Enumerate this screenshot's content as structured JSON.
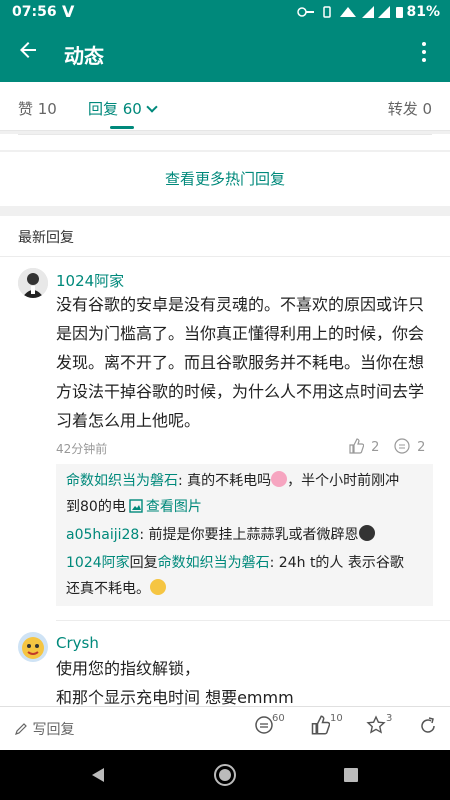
{
  "status_bar": {
    "time": "07:56",
    "battery": "81%"
  },
  "header": {
    "title": "动态"
  },
  "tabs": {
    "like": "赞 10",
    "reply": "回复 60",
    "forward": "转发 0"
  },
  "more_hot": "查看更多热门回复",
  "latest_label": "最新回复",
  "comments": [
    {
      "user": "1024阿家",
      "text_lines": [
        "没有谷歌的安卓是没有灵魂的。不喜欢的原因或许只",
        "是因为门槛高了。当你真正懂得利用上的时候，你会",
        "发现。离不开了。而且谷歌服务并不耗电。当你在想",
        "方设法干掉谷歌的时候，为什么人不用这点时间去学",
        "习着怎么用上他呢。"
      ],
      "time": "42分钟前",
      "likes": "2",
      "replies": "2",
      "subreplies": [
        {
          "user": "命数如织当为磐石",
          "text": ": 真的不耗电吗",
          "text2": "，半个小时前刚冲",
          "line2": "到80的电",
          "image_link": "查看图片"
        },
        {
          "user": "a05haiji28",
          "text": ": 前提是你要挂上蒜蒜乳或者微辟恩"
        },
        {
          "user": "1024阿家",
          "reply_word": "回复",
          "target": "命数如织当为磐石",
          "text": ": 24h t的人 表示谷歌",
          "line2": "还真不耗电。"
        }
      ]
    },
    {
      "user": "Crysh",
      "text_lines": [
        "使用您的指纹解锁，",
        "和那个显示充电时间 想要emmm"
      ]
    }
  ],
  "bottom_bar": {
    "write_reply": "写回复",
    "comment_count": "60",
    "like_count": "10",
    "star_count": "3"
  },
  "colors": {
    "accent": "#00897b",
    "separator": "#f0f0f0"
  }
}
